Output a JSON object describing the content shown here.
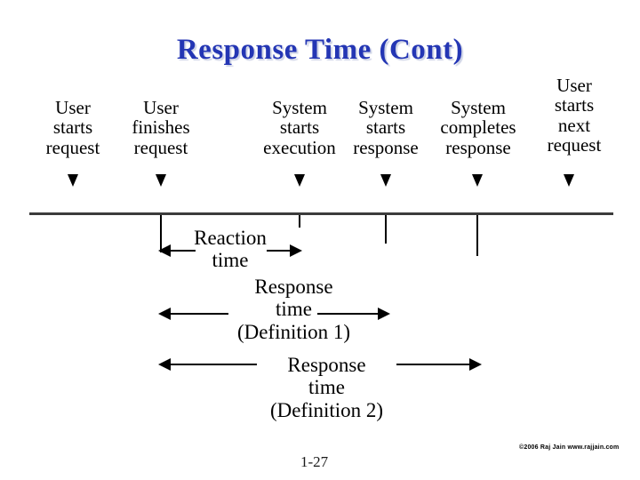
{
  "slide": {
    "title": "Response Time (Cont)",
    "title_color": "#2436b4",
    "slide_number": "1-27",
    "copyright": "©2006 Raj Jain www.rajjain.com"
  },
  "events": [
    {
      "id": "user-starts-request",
      "lines": [
        "User",
        "starts",
        "request"
      ]
    },
    {
      "id": "user-finishes-request",
      "lines": [
        "User",
        "finishes",
        "request"
      ]
    },
    {
      "id": "system-starts-execution",
      "lines": [
        "System",
        "starts",
        "execution"
      ]
    },
    {
      "id": "system-starts-response",
      "lines": [
        "System",
        "starts",
        "response"
      ]
    },
    {
      "id": "system-completes-response",
      "lines": [
        "System",
        "completes",
        "response"
      ]
    },
    {
      "id": "user-starts-next-request",
      "lines": [
        "User",
        "starts",
        "next",
        "request"
      ]
    }
  ],
  "measures": [
    {
      "id": "reaction-time",
      "lines": [
        "Reaction",
        "time"
      ]
    },
    {
      "id": "response-time-definition-1",
      "lines": [
        "Response",
        "time",
        "(Definition 1)"
      ]
    },
    {
      "id": "response-time-definition-2",
      "lines": [
        "Response",
        "time",
        "(Definition 2)"
      ]
    }
  ]
}
